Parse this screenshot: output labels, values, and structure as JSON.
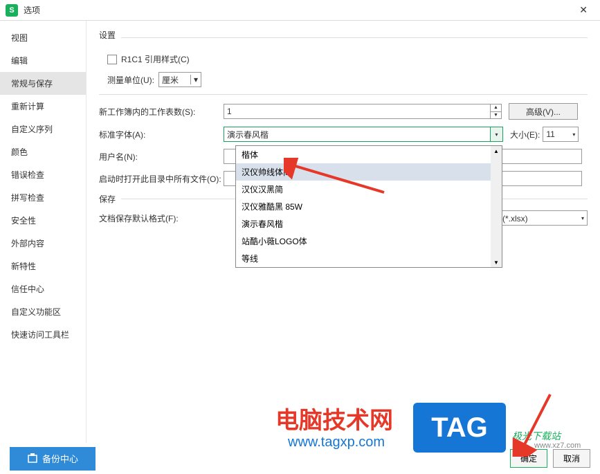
{
  "title": "选项",
  "app_icon_letter": "S",
  "close_label": "✕",
  "sidebar": {
    "items": [
      {
        "label": "视图"
      },
      {
        "label": "编辑"
      },
      {
        "label": "常规与保存"
      },
      {
        "label": "重新计算"
      },
      {
        "label": "自定义序列"
      },
      {
        "label": "颜色"
      },
      {
        "label": "错误检查"
      },
      {
        "label": "拼写检查"
      },
      {
        "label": "安全性"
      },
      {
        "label": "外部内容"
      },
      {
        "label": "新特性"
      },
      {
        "label": "信任中心"
      },
      {
        "label": "自定义功能区"
      },
      {
        "label": "快速访问工具栏"
      }
    ],
    "active_index": 2
  },
  "settings": {
    "section1_title": "设置",
    "r1c1_label": "R1C1 引用样式(C)",
    "unit_label": "测量单位(U):",
    "unit_value": "厘米",
    "sheets_label": "新工作簿内的工作表数(S):",
    "sheets_value": "1",
    "advanced_label": "高级(V)...",
    "font_label": "标准字体(A):",
    "font_value": "演示春风楷",
    "size_label": "大小(E):",
    "size_value": "11",
    "username_label": "用户名(N):",
    "username_value": "",
    "startup_label": "启动时打开此目录中所有文件(O):",
    "startup_value": "",
    "save_section": "保存",
    "save_format_label": "文档保存默认格式(F):",
    "save_format_value": "件(*.xlsx)"
  },
  "font_dropdown": {
    "items": [
      "楷体",
      "汉仪帅线体简",
      "汉仪汉黑简",
      "汉仪雅酷黑 85W",
      "演示春风楷",
      "站酷小薇LOGO体",
      "等线"
    ],
    "highlight_index": 1
  },
  "footer": {
    "backup_label": "备份中心",
    "ok_label": "确定",
    "cancel_label": "取消"
  },
  "watermarks": {
    "wm1": "电脑技术网",
    "wm1_sub": "www.tagxp.com",
    "tag_text": "TAG",
    "wm2": "极光下载站",
    "wm2_sub": "www.xz7.com"
  }
}
